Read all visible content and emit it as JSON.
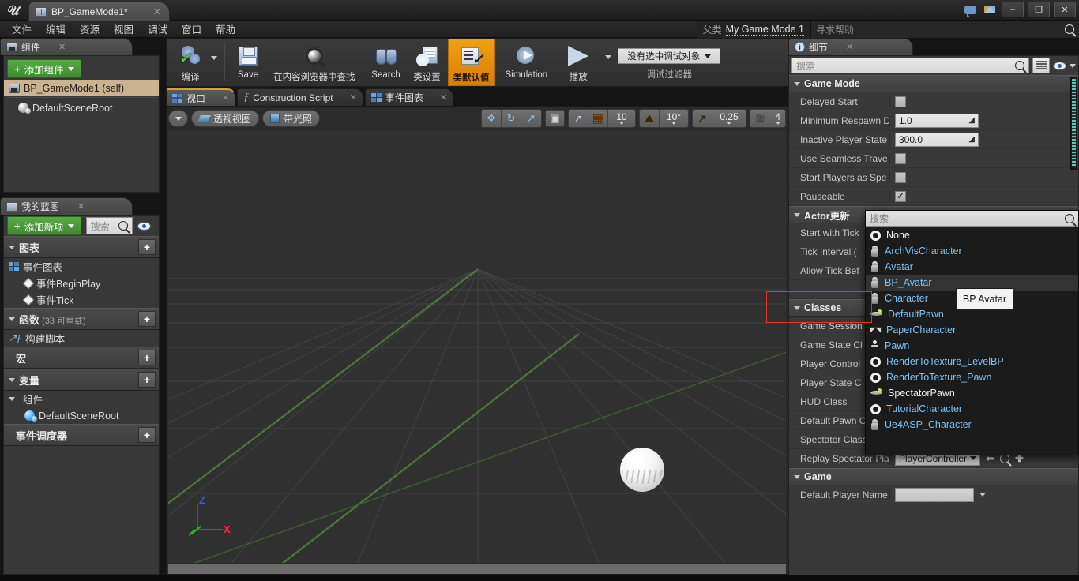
{
  "window": {
    "title": "BP_GameMode1*",
    "logo": "unreal-logo",
    "minimize": "–",
    "maximize": "❐",
    "close": "✕",
    "tab_close": "✕"
  },
  "menu": {
    "items": [
      "文件",
      "编辑",
      "资源",
      "视图",
      "调试",
      "窗口",
      "帮助"
    ]
  },
  "parent_class": {
    "label": "父类",
    "value": "My Game Mode 1"
  },
  "help_search": {
    "placeholder": "寻求帮助"
  },
  "toolbar": {
    "compile": "编译",
    "save": "Save",
    "find_in_cb": "在内容浏览器中查找",
    "search": "Search",
    "class_settings": "类设置",
    "class_defaults": "类默认值",
    "simulation": "Simulation",
    "play": "播放",
    "debug_object": "没有选中调试对象",
    "debug_filter": "调试过滤器"
  },
  "components_panel": {
    "tab_title": "组件",
    "add_component": "添加组件",
    "items": [
      {
        "label": "BP_GameMode1 (self)",
        "icon": "blueprint-gamemode-icon",
        "selected": true
      },
      {
        "label": "DefaultSceneRoot",
        "icon": "scene-root-icon",
        "selected": false
      }
    ]
  },
  "my_blueprint_panel": {
    "tab_title": "我的蓝图",
    "add_new": "添加新项",
    "search_placeholder": "搜索",
    "sections": [
      {
        "title": "图表",
        "suffix": "",
        "plus": "+",
        "children": [
          {
            "label": "事件图表",
            "icon": "graph-icon",
            "depth": 0
          },
          {
            "label": "事件BeginPlay",
            "icon": "event-node-icon",
            "depth": 1
          },
          {
            "label": "事件Tick",
            "icon": "event-node-icon",
            "depth": 1
          }
        ]
      },
      {
        "title": "函数",
        "suffix": "(33 可重载)",
        "plus": "+",
        "children": [
          {
            "label": "构建脚本",
            "icon": "function-icon",
            "depth": 0
          }
        ]
      },
      {
        "title": "宏",
        "suffix": "",
        "plus": "+",
        "children": []
      },
      {
        "title": "变量",
        "suffix": "",
        "plus": "+",
        "children": [
          {
            "label": "组件",
            "icon": "category-icon",
            "depth": 0
          },
          {
            "label": "DefaultSceneRoot",
            "icon": "scene-root-blue-icon",
            "depth": 1
          }
        ]
      },
      {
        "title": "事件调度器",
        "suffix": "",
        "plus": "+",
        "children": []
      }
    ]
  },
  "viewport": {
    "tabs": [
      {
        "label": "视口",
        "icon": "viewport-icon",
        "active": true,
        "closable": true
      },
      {
        "label": "Construction Script",
        "icon": "function-icon",
        "active": false,
        "closable": true
      },
      {
        "label": "事件图表",
        "icon": "graph-icon",
        "active": false,
        "closable": true
      }
    ],
    "view_mode": "透视视图",
    "lit_mode": "带光照",
    "grid_snap_value": "10",
    "rotation_snap_value": "10°",
    "scale_snap_value": "0.25",
    "camera_speed_value": "4"
  },
  "details_panel": {
    "tab_title": "细节",
    "search_placeholder": "搜索",
    "categories": [
      {
        "name": "Game Mode",
        "rows": [
          {
            "label": "Delayed Start",
            "type": "checkbox",
            "checked": false
          },
          {
            "label": "Minimum Respawn D",
            "type": "number",
            "value": "1.0"
          },
          {
            "label": "Inactive Player State",
            "type": "number",
            "value": "300.0"
          },
          {
            "label": "Use Seamless Trave",
            "type": "checkbox",
            "checked": false
          },
          {
            "label": "Start Players as Spe",
            "type": "checkbox",
            "checked": false
          },
          {
            "label": "Pauseable",
            "type": "checkbox",
            "checked": true
          }
        ]
      },
      {
        "name": "Actor更新",
        "rows": [
          {
            "label": "Start with Tick",
            "type": "hidden"
          },
          {
            "label": "Tick Interval (",
            "type": "hidden"
          },
          {
            "label": "Allow Tick Bef",
            "type": "hidden"
          },
          {
            "label": "",
            "type": "hidden"
          }
        ]
      },
      {
        "name": "Classes",
        "rows": [
          {
            "label": "Game Session",
            "type": "hidden"
          },
          {
            "label": "Game State Cl",
            "type": "hidden"
          },
          {
            "label": "Player Control",
            "type": "hidden"
          },
          {
            "label": "Player State C",
            "type": "hidden"
          },
          {
            "label": "HUD Class",
            "type": "hidden"
          },
          {
            "label": "Default Pawn Class",
            "type": "class",
            "value": "DefaultPawn",
            "buttons": [
              "back-arrow-icon",
              "browse-icon",
              "add-icon",
              "clear-icon"
            ]
          },
          {
            "label": "Spectator Class",
            "type": "class",
            "value": "SpectatorPawn",
            "buttons": [
              "back-arrow-icon",
              "browse-icon",
              "add-icon"
            ]
          },
          {
            "label": "Replay Spectator Pla",
            "type": "class",
            "value": "PlayerController",
            "buttons": [
              "back-arrow-icon",
              "browse-icon",
              "add-icon"
            ]
          }
        ]
      },
      {
        "name": "Game",
        "rows": [
          {
            "label": "Default Player Name",
            "type": "text",
            "value": ""
          }
        ]
      }
    ]
  },
  "class_dropdown": {
    "search_placeholder": "搜索",
    "items": [
      {
        "label": "None",
        "icon": "ring-icon",
        "native": true,
        "highlighted": false
      },
      {
        "label": "ArchVisCharacter",
        "icon": "pawn-icon",
        "native": false,
        "highlighted": false
      },
      {
        "label": "Avatar",
        "icon": "pawn-icon",
        "native": false,
        "highlighted": false
      },
      {
        "label": "BP_Avatar",
        "icon": "pawn-icon",
        "native": false,
        "highlighted": true
      },
      {
        "label": "Character",
        "icon": "pawn-icon",
        "native": false,
        "highlighted": false
      },
      {
        "label": "DefaultPawn",
        "icon": "default-pawn-icon",
        "native": false,
        "highlighted": false
      },
      {
        "label": "PaperCharacter",
        "icon": "paper-character-icon",
        "native": false,
        "highlighted": false
      },
      {
        "label": "Pawn",
        "icon": "pawn-simple-icon",
        "native": false,
        "highlighted": false
      },
      {
        "label": "RenderToTexture_LevelBP",
        "icon": "ring-icon",
        "native": false,
        "highlighted": false
      },
      {
        "label": "RenderToTexture_Pawn",
        "icon": "ring-icon",
        "native": false,
        "highlighted": false
      },
      {
        "label": "SpectatorPawn",
        "icon": "default-pawn-icon",
        "native": true,
        "highlighted": false
      },
      {
        "label": "TutorialCharacter",
        "icon": "ring-icon",
        "native": false,
        "highlighted": false
      },
      {
        "label": "Ue4ASP_Character",
        "icon": "pawn-icon",
        "native": false,
        "highlighted": false
      }
    ]
  },
  "tooltip": {
    "text": "BP Avatar"
  },
  "annotation": {
    "color": "#e8332a"
  },
  "colors": {
    "accent_orange": "#e09a12",
    "link_blue": "#7fc0f0",
    "green_button": "#4f9c3d",
    "selection_tan": "#cdb292"
  }
}
